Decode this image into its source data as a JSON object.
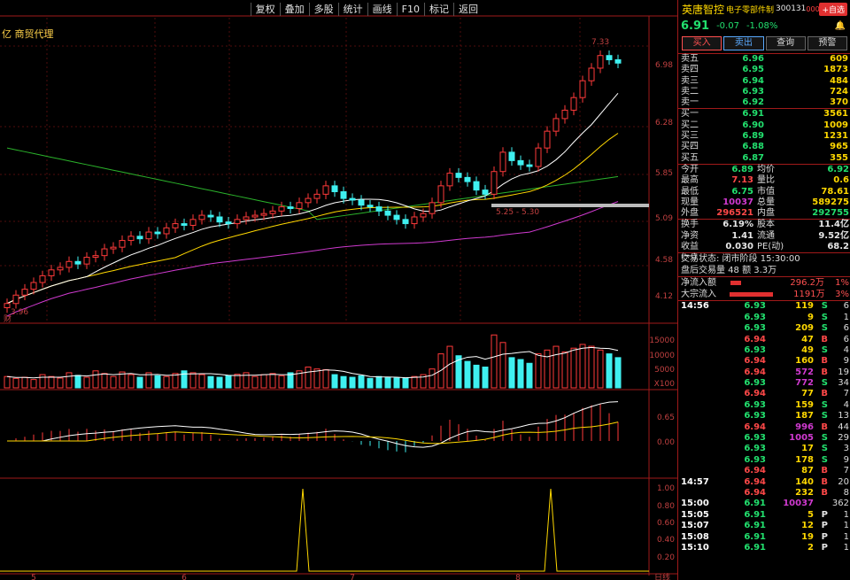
{
  "toolbar": [
    "复权",
    "叠加",
    "多股",
    "统计",
    "画线",
    "F10",
    "标记",
    "返回"
  ],
  "stock_label": "亿 商贸代理",
  "price_axis": [
    "6.98",
    "6.28",
    "5.85",
    "5.09",
    "4.58",
    "4.12"
  ],
  "volume_axis": [
    "15000",
    "10000",
    "5000",
    "X100"
  ],
  "macd_axis": [
    "0.65",
    "0.00"
  ],
  "signal_axis": [
    "1.00",
    "0.80",
    "0.60",
    "0.40",
    "0.20"
  ],
  "date_ticks": [
    "5",
    "6",
    "7",
    "8"
  ],
  "annotations": {
    "high": "7.33",
    "low": "3.96",
    "range": "5.25 - 5.30",
    "cai": "财"
  },
  "chart_data": {
    "type": "candlestick",
    "close": [
      4.05,
      4.15,
      4.22,
      4.3,
      4.38,
      4.45,
      4.48,
      4.55,
      4.52,
      4.6,
      4.62,
      4.7,
      4.72,
      4.8,
      4.85,
      4.82,
      4.9,
      4.88,
      4.95,
      5.0,
      4.98,
      5.05,
      5.1,
      5.08,
      5.02,
      5.0,
      5.05,
      5.08,
      5.1,
      5.12,
      5.15,
      5.2,
      5.18,
      5.25,
      5.3,
      5.35,
      5.45,
      5.38,
      5.3,
      5.28,
      5.22,
      5.2,
      5.15,
      5.1,
      5.05,
      5.0,
      5.08,
      5.12,
      5.25,
      5.45,
      5.6,
      5.55,
      5.5,
      5.4,
      5.35,
      5.62,
      5.85,
      5.75,
      5.7,
      5.68,
      5.9,
      6.1,
      6.25,
      6.35,
      6.5,
      6.7,
      6.85,
      7.0,
      6.95,
      6.91
    ],
    "volume": [
      30,
      25,
      28,
      22,
      35,
      30,
      26,
      40,
      33,
      28,
      45,
      38,
      30,
      42,
      35,
      28,
      40,
      32,
      30,
      38,
      45,
      40,
      35,
      30,
      28,
      33,
      36,
      40,
      30,
      35,
      38,
      32,
      40,
      45,
      55,
      50,
      48,
      35,
      30,
      28,
      32,
      25,
      30,
      28,
      26,
      25,
      30,
      35,
      50,
      90,
      110,
      85,
      70,
      60,
      55,
      140,
      120,
      80,
      75,
      65,
      90,
      100,
      110,
      95,
      105,
      115,
      110,
      100,
      90,
      80
    ],
    "signal_peaks": [
      {
        "x": "2024-07",
        "v": 1.0
      },
      {
        "x": "2024-08",
        "v": 1.0
      }
    ]
  },
  "header": {
    "name": "英唐智控",
    "industry": "电子零部件制",
    "code": "300131",
    "add_button": "+自选"
  },
  "quote": {
    "price": "6.91",
    "change": "-0.07",
    "change_pct": "-1.08%"
  },
  "trade_buttons": [
    "买入",
    "卖出",
    "查询",
    "预警"
  ],
  "asks": [
    {
      "label": "卖五",
      "price": "6.96",
      "qty": "609"
    },
    {
      "label": "卖四",
      "price": "6.95",
      "qty": "1873"
    },
    {
      "label": "卖三",
      "price": "6.94",
      "qty": "484"
    },
    {
      "label": "卖二",
      "price": "6.93",
      "qty": "724"
    },
    {
      "label": "卖一",
      "price": "6.92",
      "qty": "370"
    }
  ],
  "bids": [
    {
      "label": "买一",
      "price": "6.91",
      "qty": "3561"
    },
    {
      "label": "买二",
      "price": "6.90",
      "qty": "1009"
    },
    {
      "label": "买三",
      "price": "6.89",
      "qty": "1231"
    },
    {
      "label": "买四",
      "price": "6.88",
      "qty": "965"
    },
    {
      "label": "买五",
      "price": "6.87",
      "qty": "355"
    }
  ],
  "stats": [
    {
      "k": "今开",
      "a": "6.89",
      "k2": "均价",
      "b": "6.92"
    },
    {
      "k": "最高",
      "a": "7.13",
      "k2": "量比",
      "b": "0.6"
    },
    {
      "k": "最低",
      "a": "6.75",
      "k2": "市值",
      "b": "78.61"
    },
    {
      "k": "现量",
      "a": "10037",
      "k2": "总量",
      "b": "589275"
    },
    {
      "k": "外盘",
      "a": "296521",
      "k2": "内盘",
      "b": "292755"
    }
  ],
  "stats2": [
    {
      "k": "换手",
      "a": "6.19%",
      "k2": "股本",
      "b": "11.4亿"
    },
    {
      "k": "净资",
      "a": "1.41",
      "k2": "流通",
      "b": "9.52亿"
    },
    {
      "k": "收益(一)",
      "a": "0.030",
      "k2": "PE(动)",
      "b": "68.2"
    }
  ],
  "trade_status": "交易状态: 闭市阶段 15:30:00",
  "after_hours": "盘后交易量 48 额 3.3万",
  "flows": [
    {
      "k": "净流入额",
      "v": "296.2万",
      "pct": "1%",
      "w": 12
    },
    {
      "k": "大宗流入",
      "v": "1191万",
      "pct": "3%",
      "w": 50
    }
  ],
  "ticks": [
    {
      "t": "14:56",
      "p": "6.93",
      "v": "119",
      "s": "S",
      "n": "6"
    },
    {
      "t": "",
      "p": "6.93",
      "v": "9",
      "s": "S",
      "n": "1"
    },
    {
      "t": "",
      "p": "6.93",
      "v": "209",
      "s": "S",
      "n": "6"
    },
    {
      "t": "",
      "p": "6.94",
      "v": "47",
      "s": "B",
      "n": "6"
    },
    {
      "t": "",
      "p": "6.93",
      "v": "49",
      "s": "S",
      "n": "4"
    },
    {
      "t": "",
      "p": "6.94",
      "v": "160",
      "s": "B",
      "n": "9"
    },
    {
      "t": "",
      "p": "6.94",
      "v": "572",
      "s": "B",
      "n": "19"
    },
    {
      "t": "",
      "p": "6.93",
      "v": "772",
      "s": "S",
      "n": "34"
    },
    {
      "t": "",
      "p": "6.94",
      "v": "77",
      "s": "B",
      "n": "7"
    },
    {
      "t": "",
      "p": "6.93",
      "v": "159",
      "s": "S",
      "n": "4"
    },
    {
      "t": "",
      "p": "6.93",
      "v": "187",
      "s": "S",
      "n": "13"
    },
    {
      "t": "",
      "p": "6.94",
      "v": "996",
      "s": "B",
      "n": "44"
    },
    {
      "t": "",
      "p": "6.93",
      "v": "1005",
      "s": "S",
      "n": "29"
    },
    {
      "t": "",
      "p": "6.93",
      "v": "17",
      "s": "S",
      "n": "3"
    },
    {
      "t": "",
      "p": "6.93",
      "v": "178",
      "s": "S",
      "n": "9"
    },
    {
      "t": "",
      "p": "6.94",
      "v": "87",
      "s": "B",
      "n": "7"
    },
    {
      "t": "14:57",
      "p": "6.94",
      "v": "140",
      "s": "B",
      "n": "20"
    },
    {
      "t": "",
      "p": "6.94",
      "v": "232",
      "s": "B",
      "n": "8"
    },
    {
      "t": "15:00",
      "p": "6.91",
      "v": "10037",
      "s": "",
      "n": "362"
    },
    {
      "t": "15:05",
      "p": "6.91",
      "v": "5",
      "s": "P",
      "n": "1"
    },
    {
      "t": "15:07",
      "p": "6.91",
      "v": "12",
      "s": "P",
      "n": "1"
    },
    {
      "t": "15:08",
      "p": "6.91",
      "v": "19",
      "s": "P",
      "n": "1"
    },
    {
      "t": "15:10",
      "p": "6.91",
      "v": "2",
      "s": "P",
      "n": "1"
    }
  ],
  "bottom_tab": "日线"
}
